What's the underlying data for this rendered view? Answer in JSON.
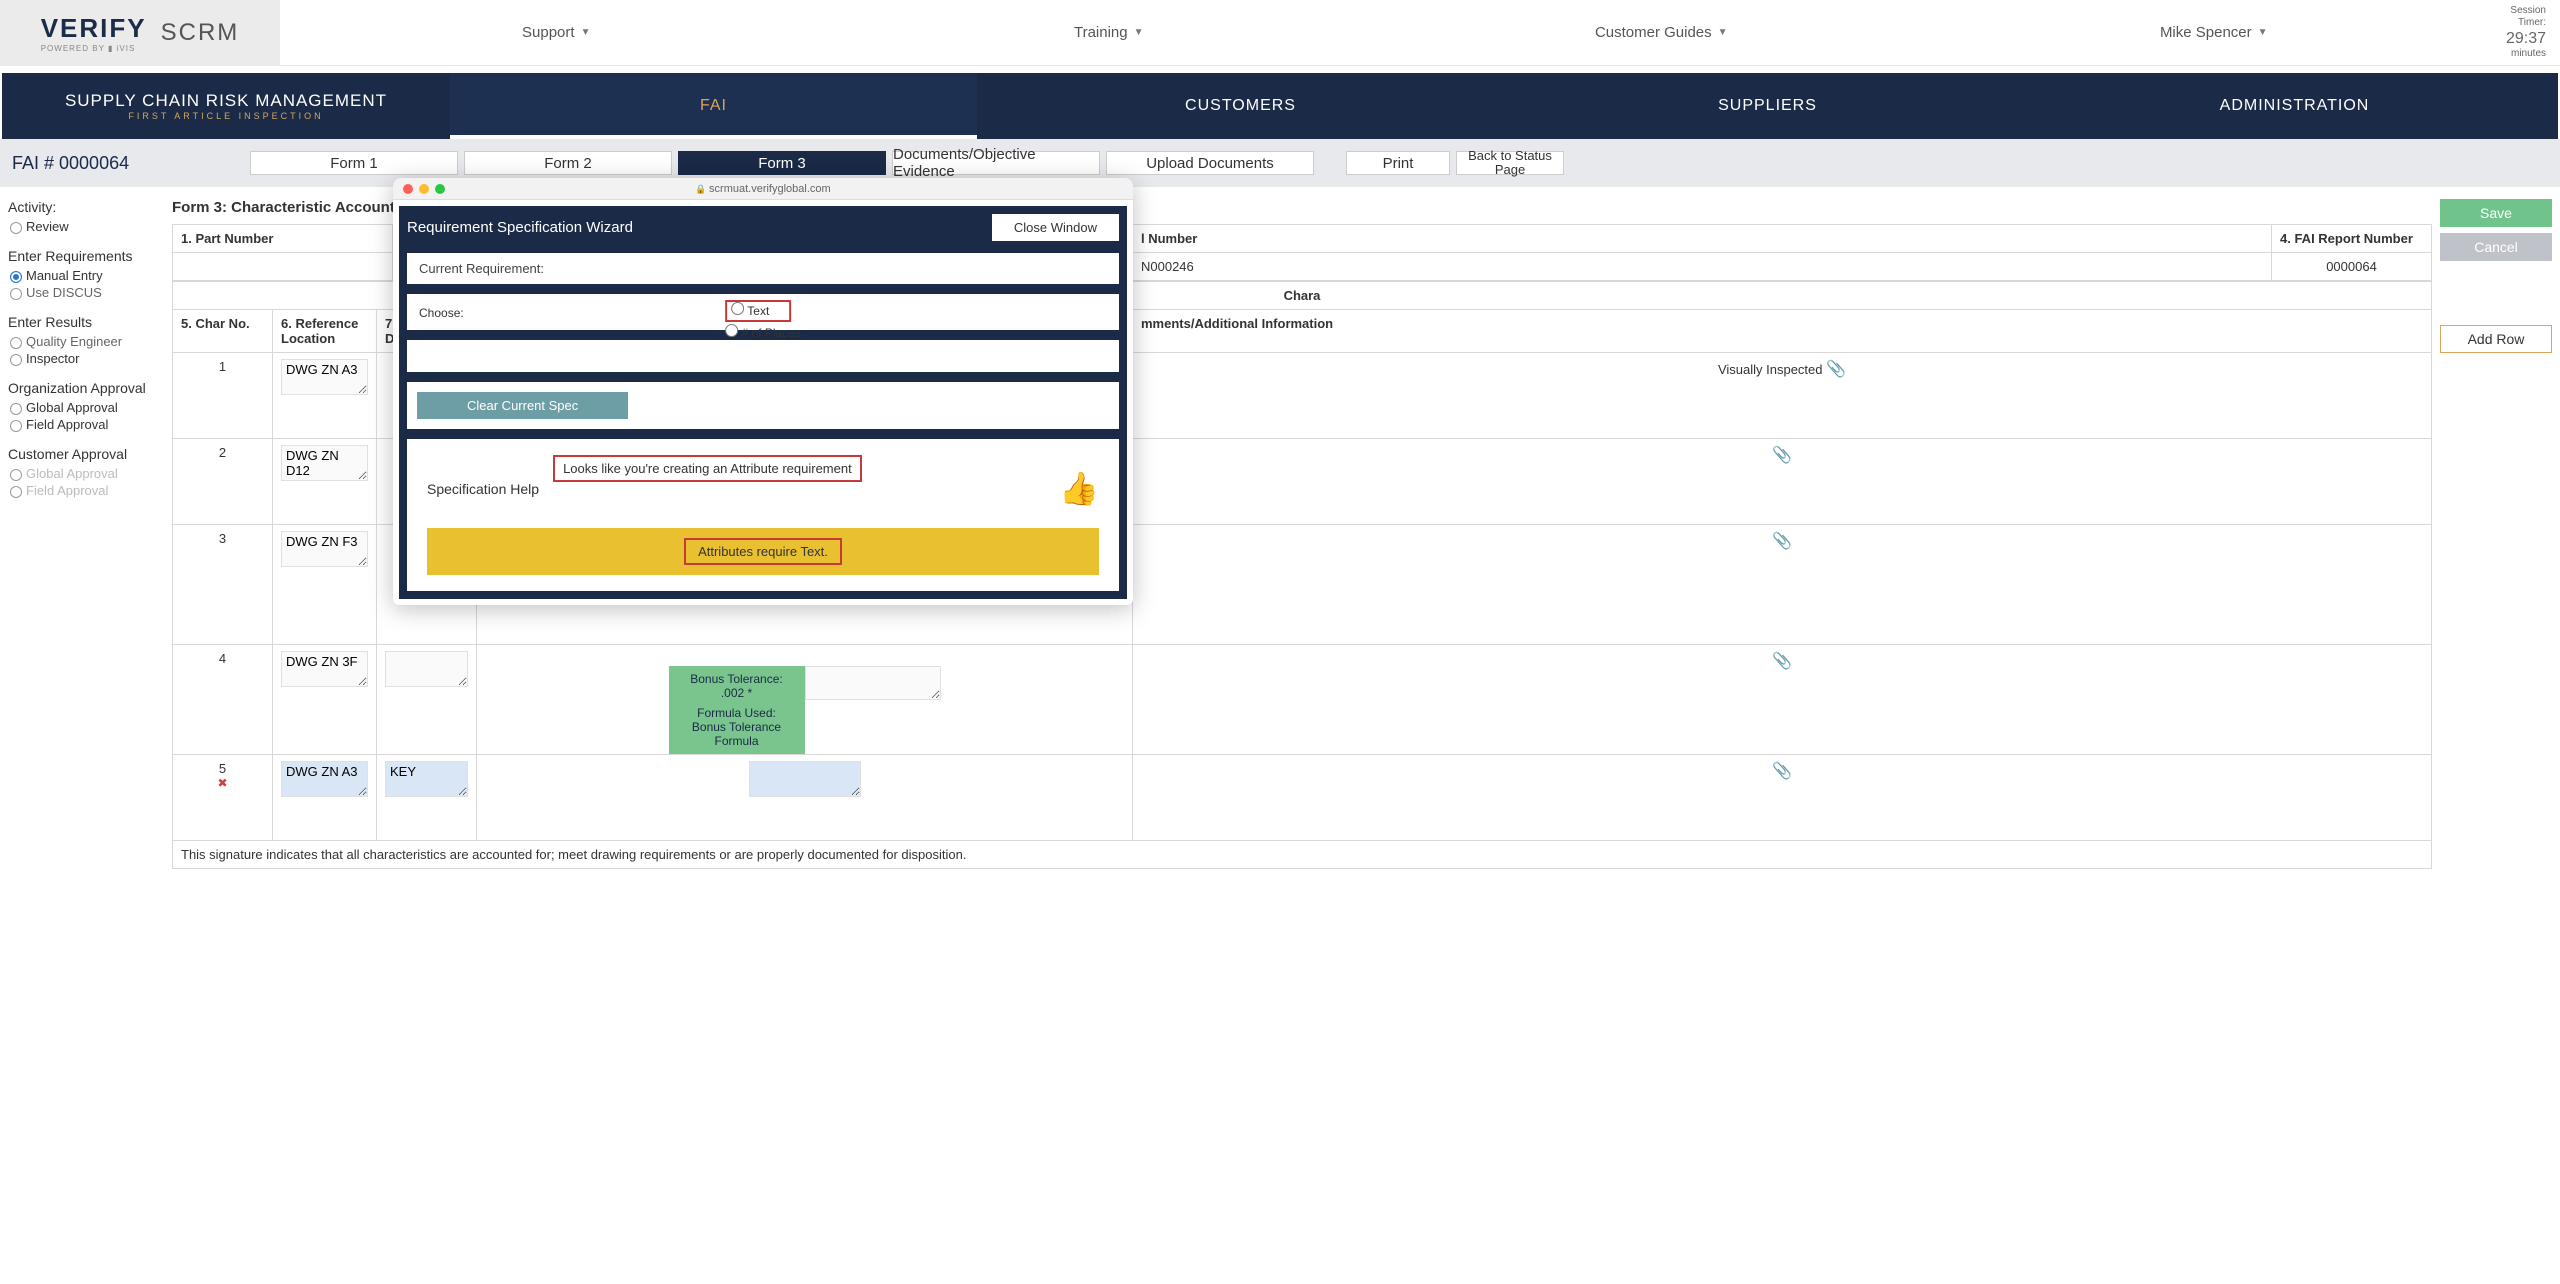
{
  "header": {
    "logo_text": "VERIFY",
    "logo_sub": "POWERED BY ▮ iVIS",
    "product": "SCRM",
    "links": {
      "support": "Support",
      "training": "Training",
      "guides": "Customer Guides",
      "user": "Mike Spencer"
    },
    "session": {
      "l1": "Session",
      "l2": "Timer:",
      "time": "29:37",
      "l3": "minutes"
    }
  },
  "nav": {
    "title": "SUPPLY CHAIN RISK MANAGEMENT",
    "subtitle": "FIRST ARTICLE INSPECTION",
    "tabs": {
      "fai": "FAI",
      "customers": "CUSTOMERS",
      "suppliers": "SUPPLIERS",
      "admin": "ADMINISTRATION"
    }
  },
  "toolbar": {
    "fai_id": "FAI # 0000064",
    "form1": "Form 1",
    "form2": "Form 2",
    "form3": "Form 3",
    "docs": "Documents/Objective Evidence",
    "upload": "Upload Documents",
    "print": "Print",
    "back1": "Back to Status",
    "back2": "Page"
  },
  "sidebar": {
    "activity": "Activity:",
    "review": "Review",
    "enter_req": "Enter Requirements",
    "manual": "Manual Entry",
    "discus": "Use DISCUS",
    "enter_res": "Enter Results",
    "qe": "Quality Engineer",
    "insp": "Inspector",
    "org_app": "Organization Approval",
    "global": "Global Approval",
    "field": "Field Approval",
    "cust_app": "Customer Approval"
  },
  "form": {
    "title": "Form 3: Characteristic Accountability, Ve",
    "headers": {
      "part_no": "1. Part Number",
      "num": "l Number",
      "fai_report": "4. FAI Report Number",
      "chara": "Chara",
      "char_no": "5. Char No.",
      "ref_loc": "6. Reference Location",
      "char_des": "7. C\nDe",
      "comments": "mments/Additional Information"
    },
    "values": {
      "number": "N000246",
      "report": "0000064"
    },
    "rows": [
      {
        "no": "1",
        "ref": "DWG ZN A3",
        "comments": "Visually Inspected"
      },
      {
        "no": "2",
        "ref": "DWG ZN D12",
        "comments": ""
      },
      {
        "no": "3",
        "ref": "DWG ZN F3",
        "comments": ""
      },
      {
        "no": "4",
        "ref": "DWG ZN 3F",
        "comments": ""
      },
      {
        "no": "5",
        "ref": "DWG ZN A3",
        "des": "KEY",
        "x": true
      }
    ],
    "bonus": {
      "l1": "Bonus Tolerance:",
      "l2": ".002 *",
      "l3": "Formula Used:",
      "l4": "Bonus Tolerance",
      "l5": "Formula"
    },
    "signature": "This signature indicates that all characteristics are accounted for; meet drawing requirements or are properly documented for disposition."
  },
  "right": {
    "save": "Save",
    "cancel": "Cancel",
    "add": "Add Row"
  },
  "modal": {
    "url": "scrmuat.verifyglobal.com",
    "title": "Requirement Specification Wizard",
    "close": "Close Window",
    "current": "Current Requirement:",
    "choose": "Choose:",
    "opt_text": "Text",
    "opt_places": "# of Places",
    "clear": "Clear Current Spec",
    "help": "Specification Help",
    "msg1": "Looks like you're creating an Attribute requirement",
    "msg2": "Attributes require Text."
  }
}
